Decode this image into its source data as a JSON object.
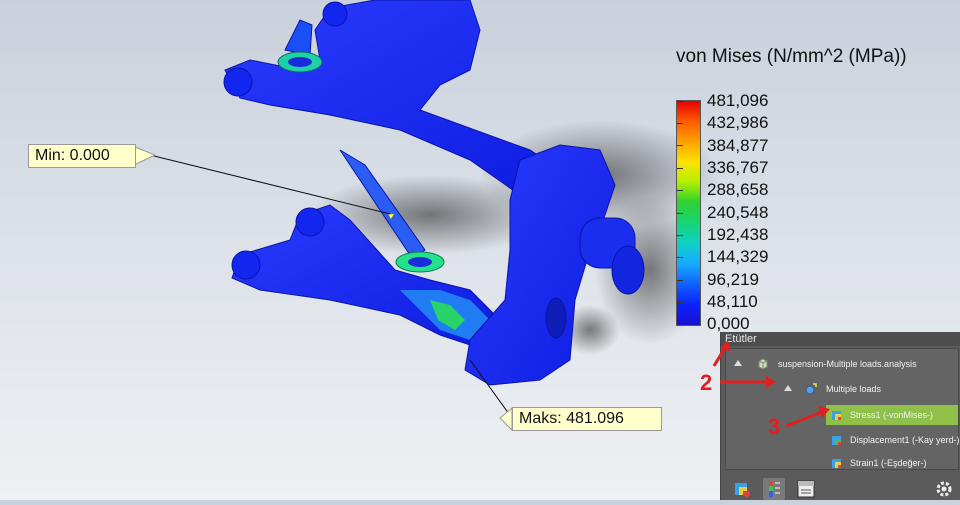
{
  "legend": {
    "title": "von Mises (N/mm^2 (MPa))",
    "ticks": [
      "481,096",
      "432,986",
      "384,877",
      "336,767",
      "288,658",
      "240,548",
      "192,438",
      "144,329",
      "96,219",
      "48,110",
      "0,000"
    ],
    "colors": {
      "max": "#e60000",
      "mid": "#2ed12e",
      "min": "#1a0fd0"
    }
  },
  "probes": {
    "min_label": "Min: 0.000",
    "max_label": "Maks: 481.096"
  },
  "panel": {
    "title": "Etütler",
    "items": [
      {
        "label": "suspension-Multiple loads.analysis",
        "icon": "analysis-icon"
      },
      {
        "label": "Multiple loads",
        "icon": "study-icon"
      },
      {
        "label": "Stress1 (-vonMises-)",
        "icon": "stress-plot-icon",
        "selected": true
      },
      {
        "label": "Displacement1 (-Kay yerd-)",
        "icon": "displacement-plot-icon"
      },
      {
        "label": "Strain1 (-Eşdeğer-)",
        "icon": "strain-plot-icon"
      }
    ],
    "toolbar": [
      "results-icon",
      "color-bar-icon",
      "labels-icon",
      "settings-icon"
    ]
  },
  "annotations": [
    "2",
    "3"
  ]
}
